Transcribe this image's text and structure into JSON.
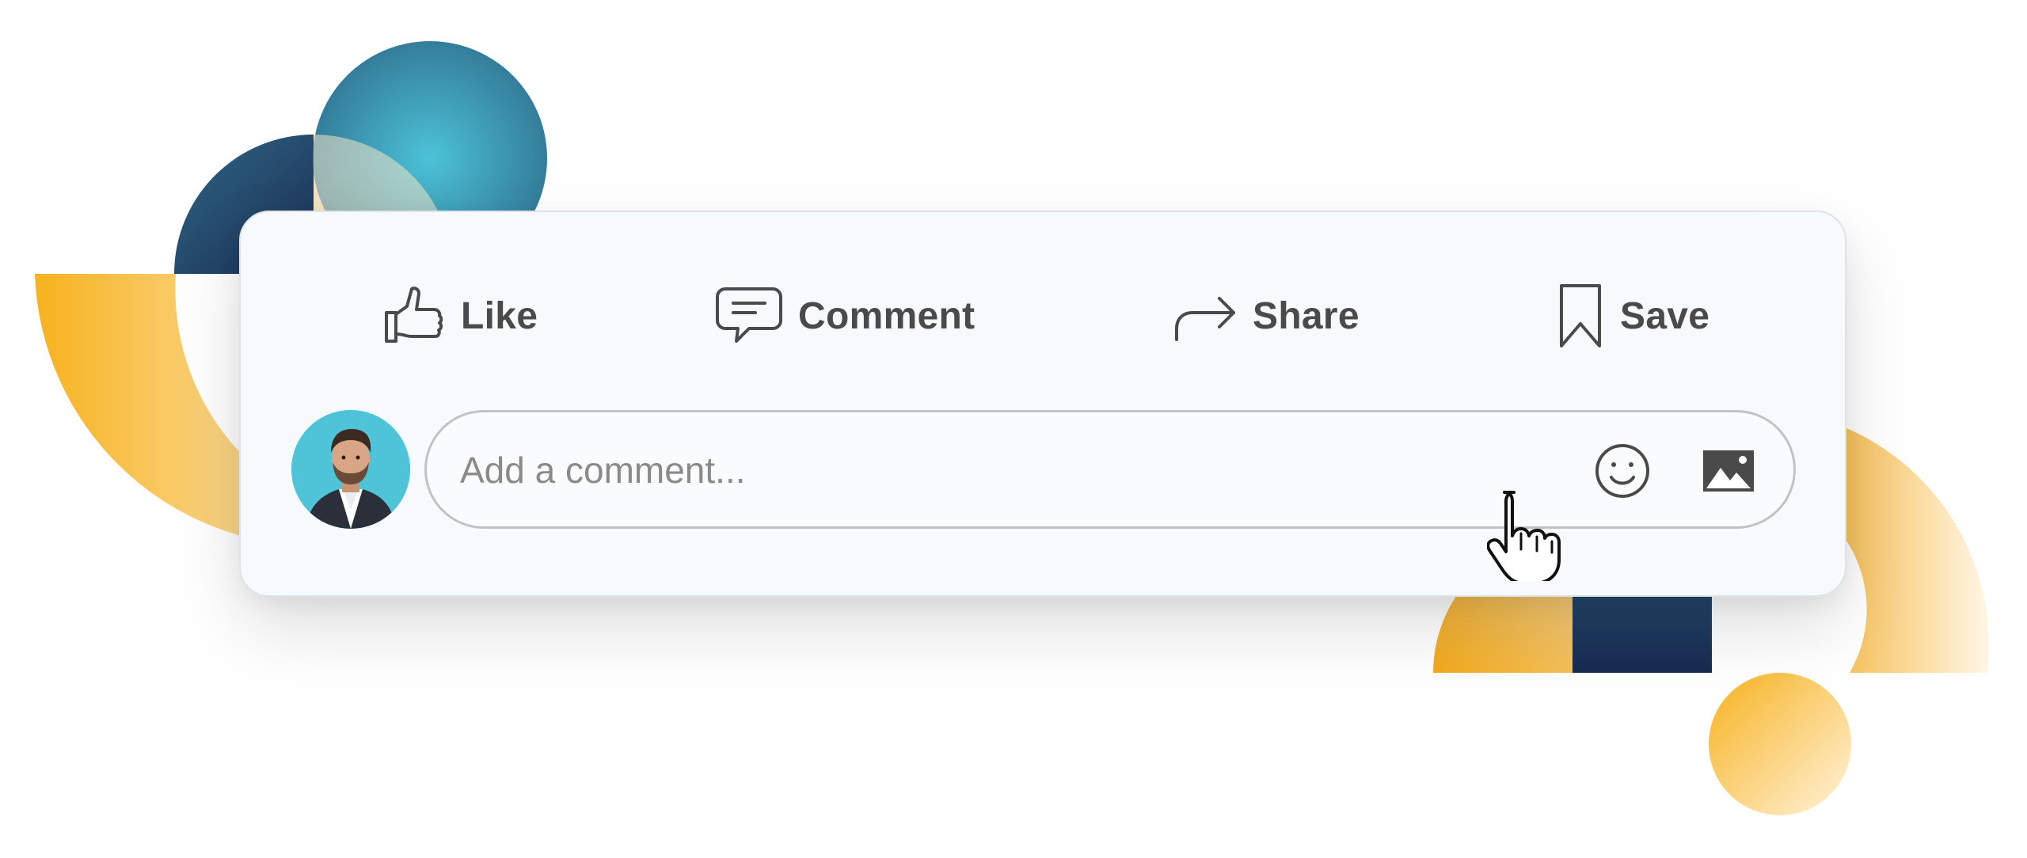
{
  "post_actions": {
    "like": {
      "label": "Like",
      "icon": "thumbs-up-icon"
    },
    "comment": {
      "label": "Comment",
      "icon": "speech-bubble-icon"
    },
    "share": {
      "label": "Share",
      "icon": "share-arrow-icon"
    },
    "save": {
      "label": "Save",
      "icon": "bookmark-icon"
    }
  },
  "comment_box": {
    "placeholder": "Add a comment...",
    "emoji_icon": "smiley-icon",
    "image_icon": "image-icon"
  },
  "user": {
    "avatar": "user-avatar"
  },
  "colors": {
    "card_bg": "#f7fafc",
    "text": "#4a4a4a",
    "placeholder": "#8a8a8a",
    "accent_teal": "#4fc4d9",
    "accent_navy": "#1d3557",
    "accent_yellow": "#f7b21e"
  }
}
